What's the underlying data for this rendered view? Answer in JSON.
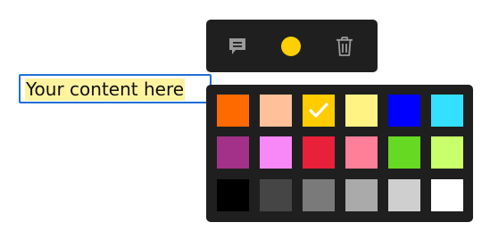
{
  "editor": {
    "highlighted_text": "Your content here",
    "highlight_color": "#fff3a0",
    "focus_border_color": "#1f6fd6"
  },
  "toolbar": {
    "background": "#1f1f1f",
    "icon_color": "#9a9a9a",
    "buttons": [
      {
        "name": "comment",
        "icon": "comment-icon"
      },
      {
        "name": "color",
        "icon": "color-dot",
        "color": "#ffd000"
      },
      {
        "name": "delete",
        "icon": "trash-icon"
      }
    ]
  },
  "palette": {
    "background": "#1f1f1f",
    "selected": "#ffcc00",
    "rows": [
      [
        "#ff6a00",
        "#ffc09a",
        "#ffcc00",
        "#fff383",
        "#0000ff",
        "#33e0ff"
      ],
      [
        "#a33189",
        "#f888f8",
        "#e8203a",
        "#ff7f98",
        "#66d922",
        "#c8ff6a"
      ],
      [
        "#000000",
        "#454545",
        "#7a7a7a",
        "#aaaaaa",
        "#cfcfcf",
        "#ffffff"
      ]
    ]
  }
}
